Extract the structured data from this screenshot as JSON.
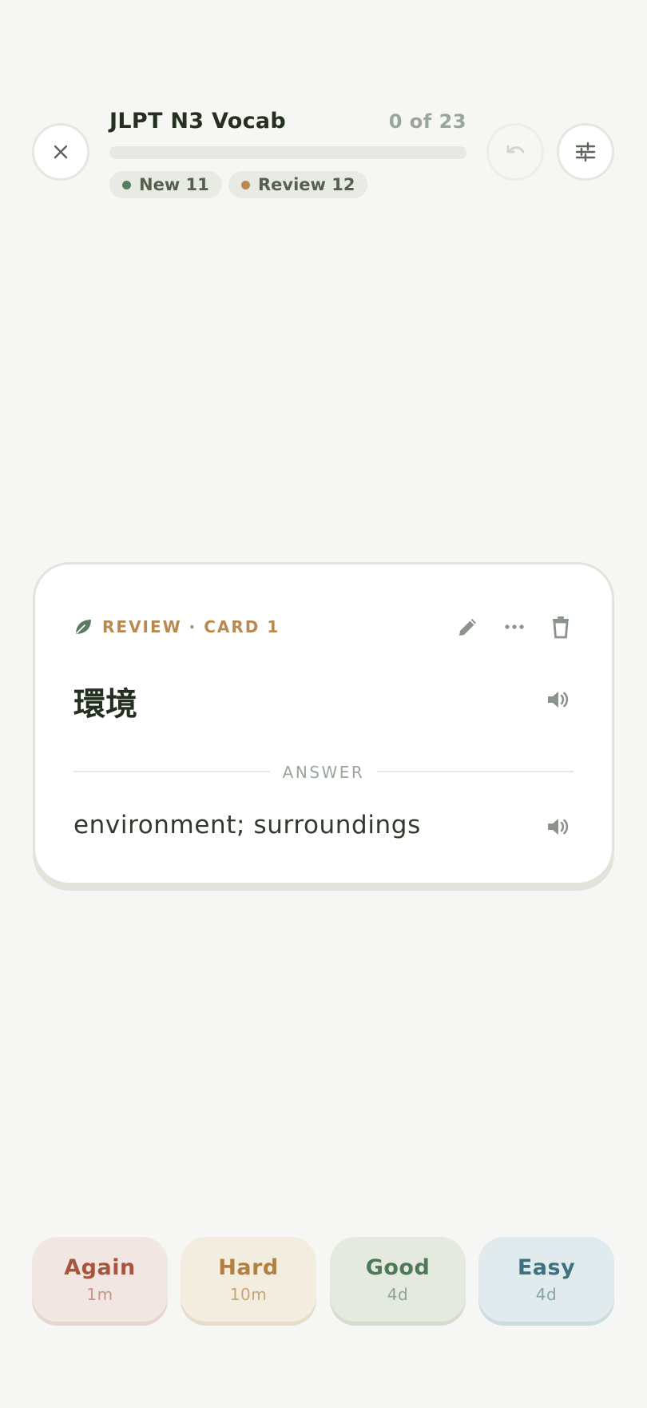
{
  "deck": {
    "title": "JLPT N3 Vocab",
    "counter": "0 of 23",
    "progress": 0
  },
  "chips": {
    "new_label": "New 11",
    "new_color": "#5a7d62",
    "review_label": "Review 12",
    "review_color": "#b98a4f"
  },
  "header_icons": {
    "close": "close-icon",
    "undo": "undo-icon",
    "settings": "sliders-icon"
  },
  "card": {
    "meta": "REVIEW · CARD 1",
    "meta_icon": "leaf-icon",
    "front": "環境",
    "divider_label": "ANSWER",
    "back": "environment; surroundings",
    "action_icons": [
      "pencil-icon",
      "more-icon",
      "trash-icon"
    ],
    "audio_icon": "speaker-icon"
  },
  "ratings": [
    {
      "label": "Again",
      "interval": "1m"
    },
    {
      "label": "Hard",
      "interval": "10m"
    },
    {
      "label": "Good",
      "interval": "4d"
    },
    {
      "label": "Easy",
      "interval": "4d"
    }
  ]
}
